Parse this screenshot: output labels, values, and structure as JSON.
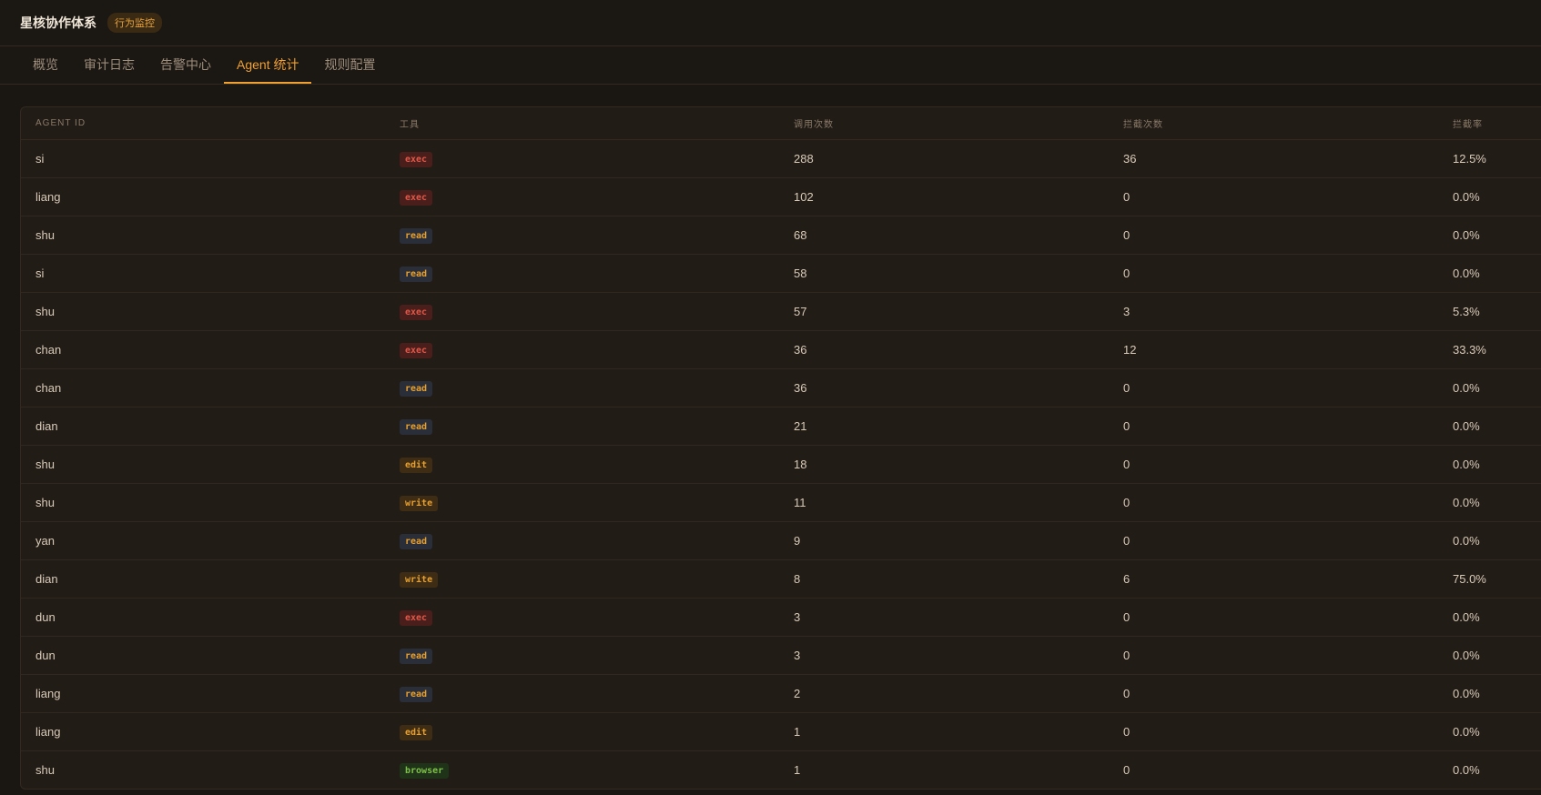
{
  "header": {
    "title": "星核协作体系",
    "badge": "行为监控"
  },
  "tabs": [
    "概览",
    "审计日志",
    "告警中心",
    "Agent 统计",
    "规则配置"
  ],
  "active_tab": "Agent 统计",
  "columns": [
    "AGENT ID",
    "工具",
    "调用次数",
    "拦截次数",
    "拦截率"
  ],
  "rows": [
    {
      "agent": "si",
      "tool": "exec",
      "calls": "288",
      "blocked": "36",
      "rate": "12.5%"
    },
    {
      "agent": "liang",
      "tool": "exec",
      "calls": "102",
      "blocked": "0",
      "rate": "0.0%"
    },
    {
      "agent": "shu",
      "tool": "read",
      "calls": "68",
      "blocked": "0",
      "rate": "0.0%"
    },
    {
      "agent": "si",
      "tool": "read",
      "calls": "58",
      "blocked": "0",
      "rate": "0.0%"
    },
    {
      "agent": "shu",
      "tool": "exec",
      "calls": "57",
      "blocked": "3",
      "rate": "5.3%"
    },
    {
      "agent": "chan",
      "tool": "exec",
      "calls": "36",
      "blocked": "12",
      "rate": "33.3%"
    },
    {
      "agent": "chan",
      "tool": "read",
      "calls": "36",
      "blocked": "0",
      "rate": "0.0%"
    },
    {
      "agent": "dian",
      "tool": "read",
      "calls": "21",
      "blocked": "0",
      "rate": "0.0%"
    },
    {
      "agent": "shu",
      "tool": "edit",
      "calls": "18",
      "blocked": "0",
      "rate": "0.0%"
    },
    {
      "agent": "shu",
      "tool": "write",
      "calls": "11",
      "blocked": "0",
      "rate": "0.0%"
    },
    {
      "agent": "yan",
      "tool": "read",
      "calls": "9",
      "blocked": "0",
      "rate": "0.0%"
    },
    {
      "agent": "dian",
      "tool": "write",
      "calls": "8",
      "blocked": "6",
      "rate": "75.0%"
    },
    {
      "agent": "dun",
      "tool": "exec",
      "calls": "3",
      "blocked": "0",
      "rate": "0.0%"
    },
    {
      "agent": "dun",
      "tool": "read",
      "calls": "3",
      "blocked": "0",
      "rate": "0.0%"
    },
    {
      "agent": "liang",
      "tool": "read",
      "calls": "2",
      "blocked": "0",
      "rate": "0.0%"
    },
    {
      "agent": "liang",
      "tool": "edit",
      "calls": "1",
      "blocked": "0",
      "rate": "0.0%"
    },
    {
      "agent": "shu",
      "tool": "browser",
      "calls": "1",
      "blocked": "0",
      "rate": "0.0%"
    }
  ],
  "colors": {
    "accent": "#f0a030",
    "background": "#1a1612",
    "panel": "#221c17",
    "exec": "#e0584a",
    "browser": "#7fc04a"
  }
}
